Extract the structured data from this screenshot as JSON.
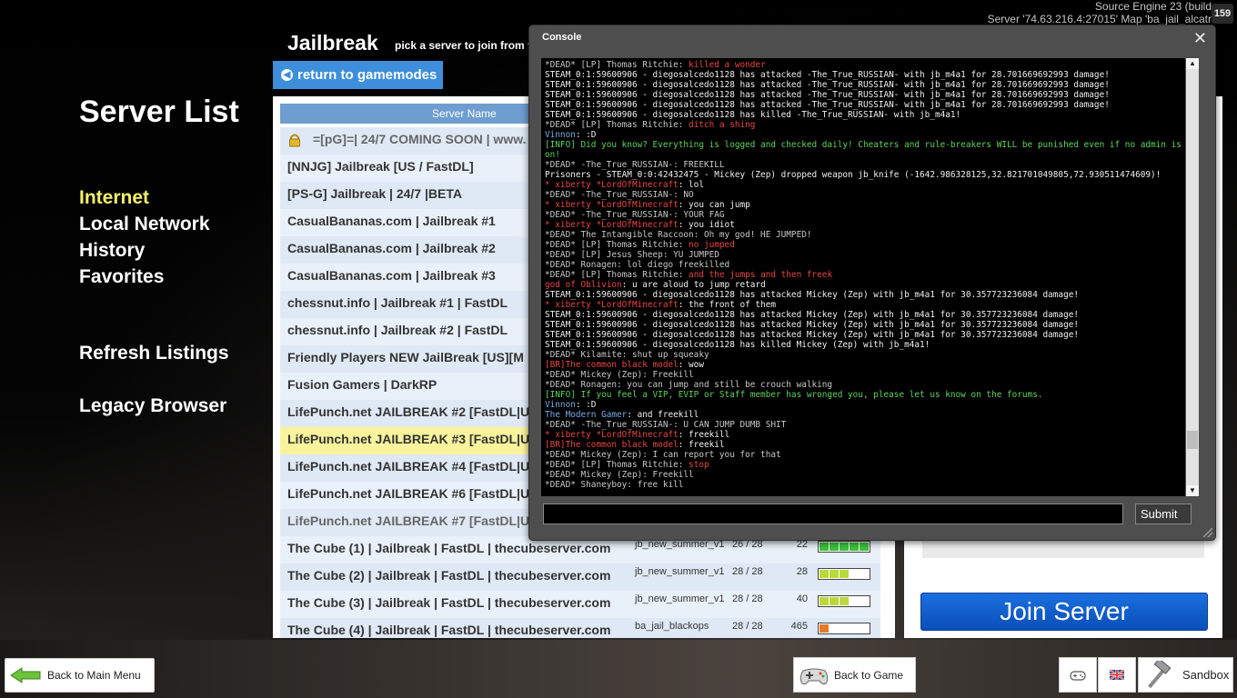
{
  "engine": {
    "line1": "Source Engine 23 (build",
    "line2": "Server '74.63.216.4:27015' Map 'ba_jail_alcatr",
    "fps": "159"
  },
  "left_menu": {
    "title": "Server List",
    "nav": [
      "Internet",
      "Local Network",
      "History",
      "Favorites"
    ],
    "refresh": "Refresh Listings",
    "legacy": "Legacy Browser"
  },
  "header": {
    "title": "Jailbreak",
    "subtitle": "pick a server to join from t",
    "return_label": "return to gamemodes"
  },
  "server_list": {
    "column_name": "Server Name",
    "rows": [
      {
        "name": "=[pG]=| 24/7 COMING SOON | www.",
        "locked": true
      },
      {
        "name": "[NNJG] Jailbreak [US / FastDL]"
      },
      {
        "name": "[PS-G] Jailbreak | 24/7 |BETA"
      },
      {
        "name": "CasualBananas.com | Jailbreak #1"
      },
      {
        "name": "CasualBananas.com | Jailbreak #2"
      },
      {
        "name": "CasualBananas.com | Jailbreak #3"
      },
      {
        "name": "chessnut.info | Jailbreak #1 | FastDL"
      },
      {
        "name": "chessnut.info | Jailbreak #2 | FastDL"
      },
      {
        "name": "Friendly Players NEW JailBreak [US][M"
      },
      {
        "name": "Fusion Gamers | DarkRP"
      },
      {
        "name": "LifePunch.net JAILBREAK #2 [FastDL|U"
      },
      {
        "name": "LifePunch.net JAILBREAK #3 [FastDL|U",
        "highlighted": true
      },
      {
        "name": "LifePunch.net JAILBREAK #4 [FastDL|U"
      },
      {
        "name": "LifePunch.net JAILBREAK #6 [FastDL|U"
      },
      {
        "name": "LifePunch.net JAILBREAK #7 [FastDL|U",
        "dim": true
      },
      {
        "name": "The Cube (1) | Jailbreak | FastDL | thecubeserver.com",
        "map": "jb_new_summer_v1",
        "players": "26 / 28",
        "ping": "22",
        "quality": 1.0,
        "quality_color": "#3cc43c"
      },
      {
        "name": "The Cube (2) | Jailbreak | FastDL | thecubeserver.com",
        "map": "jb_new_summer_v1",
        "players": "28 / 28",
        "ping": "28",
        "quality": 0.6,
        "quality_color": "#b9d93a"
      },
      {
        "name": "The Cube (3) | Jailbreak | FastDL | thecubeserver.com",
        "map": "jb_new_summer_v1",
        "players": "28 / 28",
        "ping": "40",
        "quality": 0.6,
        "quality_color": "#b9d93a"
      },
      {
        "name": "The Cube (4) | Jailbreak | FastDL | thecubeserver.com",
        "map": "ba_jail_blackops",
        "players": "28 / 28",
        "ping": "465",
        "quality": 0.2,
        "quality_color": "#e8792a"
      }
    ]
  },
  "join_label": "Join Server",
  "console": {
    "title": "Console",
    "close": "✕",
    "submit": "Submit",
    "input_value": "",
    "lines": [
      {
        "t": "*DEAD* [LP] Thomas Ritchie: ",
        "c": "g",
        "r": "killed a wonder"
      },
      {
        "t": "STEAM_0:1:59600906 - diegosalcedo1128 has attacked -The_True_RUSSIAN- with jb_m4a1 for 28.701669692993 damage!",
        "c": "w"
      },
      {
        "t": "STEAM_0:1:59600906 - diegosalcedo1128 has attacked -The_True_RUSSIAN- with jb_m4a1 for 28.701669692993 damage!",
        "c": "w"
      },
      {
        "t": "STEAM_0:1:59600906 - diegosalcedo1128 has attacked -The_True_RUSSIAN- with jb_m4a1 for 28.701669692993 damage!",
        "c": "w"
      },
      {
        "t": "STEAM_0:1:59600906 - diegosalcedo1128 has attacked -The_True_RUSSIAN- with jb_m4a1 for 28.701669692993 damage!",
        "c": "w"
      },
      {
        "t": "STEAM_0:1:59600906 - diegosalcedo1128 has killed -The_True_RUSSIAN- with jb_m4a1!",
        "c": "w"
      },
      {
        "t": "*DEAD* [LP] Thomas Ritchie: ",
        "c": "g",
        "r": "ditch a shing"
      },
      {
        "t": "Vinnon",
        "c": "b",
        "w": ": :D"
      },
      {
        "t": "[INFO] Did you know? Everything is logged and checked daily! Cheaters and rule-breakers WILL be punished even if no admin is on!",
        "c": "gr"
      },
      {
        "t": "*DEAD* -The_True_RUSSIAN-: FREEKILL",
        "c": "g"
      },
      {
        "t": "Prisoners - STEAM_0:0:42432475 - Mickey (Zep) dropped weapon jb_knife (-1642.986328125,32.821701049805,72.930511474609)!",
        "c": "w"
      },
      {
        "t": "* xiberty *LordOfMinecraft",
        "c": "r",
        "w": ": lol"
      },
      {
        "t": "*DEAD* -The_True_RUSSIAN-: NO",
        "c": "g"
      },
      {
        "t": "* xiberty *LordOfMinecraft",
        "c": "r",
        "w": ": you can jump"
      },
      {
        "t": "*DEAD* -The_True_RUSSIAN-: YOUR FAG",
        "c": "g"
      },
      {
        "t": "* xiberty *LordOfMinecraft",
        "c": "r",
        "w": ": you idiot"
      },
      {
        "t": "*DEAD* The Intangible Raccoon: Oh my god! HE JUMPED!",
        "c": "g"
      },
      {
        "t": "*DEAD* [LP] Thomas Ritchie: ",
        "c": "g",
        "r": "no jumped"
      },
      {
        "t": "*DEAD* [LP] Jesus Sheep: YU JUMPED",
        "c": "g"
      },
      {
        "t": "*DEAD* Ronagen: lol diego freekilled",
        "c": "g"
      },
      {
        "t": "*DEAD* [LP] Thomas Ritchie: ",
        "c": "g",
        "r": "and the jumps and then freek"
      },
      {
        "t": "god of Oblivion",
        "c": "r",
        "w": ": u are aloud to jump retard"
      },
      {
        "t": "STEAM_0:1:59600906 - diegosalcedo1128 has attacked Mickey (Zep) with jb_m4a1 for 30.357723236084 damage!",
        "c": "w"
      },
      {
        "t": "* xiberty *LordOfMinecraft",
        "c": "r",
        "w": ": the front of them"
      },
      {
        "t": "STEAM_0:1:59600906 - diegosalcedo1128 has attacked Mickey (Zep) with jb_m4a1 for 30.357723236084 damage!",
        "c": "w"
      },
      {
        "t": "STEAM_0:1:59600906 - diegosalcedo1128 has attacked Mickey (Zep) with jb_m4a1 for 30.357723236084 damage!",
        "c": "w"
      },
      {
        "t": "STEAM_0:1:59600906 - diegosalcedo1128 has attacked Mickey (Zep) with jb_m4a1 for 30.357723236084 damage!",
        "c": "w"
      },
      {
        "t": "STEAM_0:1:59600906 - diegosalcedo1128 has killed Mickey (Zep) with jb_m4a1!",
        "c": "w"
      },
      {
        "t": "*DEAD* Kilamite: shut up squeaky",
        "c": "g"
      },
      {
        "t": "[BR]The common black model",
        "c": "r",
        "w": ": wow"
      },
      {
        "t": "*DEAD* Mickey (Zep): Freekill",
        "c": "g"
      },
      {
        "t": "*DEAD* Ronagen: you can jump and still be crouch walking",
        "c": "g"
      },
      {
        "t": "[INFO] If you feel a VIP, EVIP or Staff member has wronged you, please let us know on the forums.",
        "c": "gr"
      },
      {
        "t": "Vinnon",
        "c": "b",
        "w": ": :D"
      },
      {
        "t": "The Modern Gamer",
        "c": "b",
        "w": ": and freekill"
      },
      {
        "t": "*DEAD* -The_True_RUSSIAN-: U CAN JUMP DUMB SHIT",
        "c": "g"
      },
      {
        "t": "* xiberty *LordOfMinecraft",
        "c": "r",
        "w": ": freekill"
      },
      {
        "t": "[BR]The common black model",
        "c": "r",
        "w": ": freekil"
      },
      {
        "t": "*DEAD* Mickey (Zep): I can report you for that",
        "c": "g"
      },
      {
        "t": "*DEAD* [LP] Thomas Ritchie: ",
        "c": "g",
        "r": "stop"
      },
      {
        "t": "*DEAD* Mickey (Zep): Freekill",
        "c": "g"
      },
      {
        "t": "*DEAD* Shaneyboy: free kill",
        "c": "g"
      }
    ]
  },
  "bottom": {
    "back_main": "Back to Main Menu",
    "back_game": "Back to Game",
    "sandbox": "Sandbox"
  }
}
